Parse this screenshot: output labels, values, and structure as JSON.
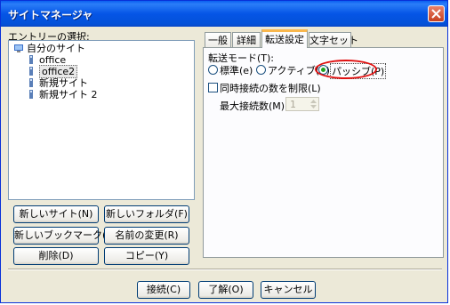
{
  "window": {
    "title": "サイトマネージャ"
  },
  "entries": {
    "label": "エントリーの選択:",
    "root": "自分のサイト",
    "items": [
      "office",
      "office2",
      "新規サイト",
      "新規サイト 2"
    ]
  },
  "left_buttons": {
    "new_site": "新しいサイト(N)",
    "new_folder": "新しいフォルダ(F)",
    "new_bookmark": "新しいブックマーク(M)",
    "rename": "名前の変更(R)",
    "delete": "削除(D)",
    "copy": "コピー(Y)"
  },
  "tabs": [
    "一般",
    "詳細",
    "転送設定",
    "文字セット"
  ],
  "transfer": {
    "mode_label": "転送モード(T):",
    "mode_options": [
      "標準(e)",
      "アクティブ(A)",
      "パッシブ(P)"
    ],
    "selected_mode": "パッシブ(P)",
    "limit_label": "同時接続の数を制限(L)",
    "max_label": "最大接続数(M):",
    "max_value": "1"
  },
  "bottom_buttons": {
    "connect": "接続(C)",
    "ok": "了解(O)",
    "cancel": "キャンセル"
  }
}
